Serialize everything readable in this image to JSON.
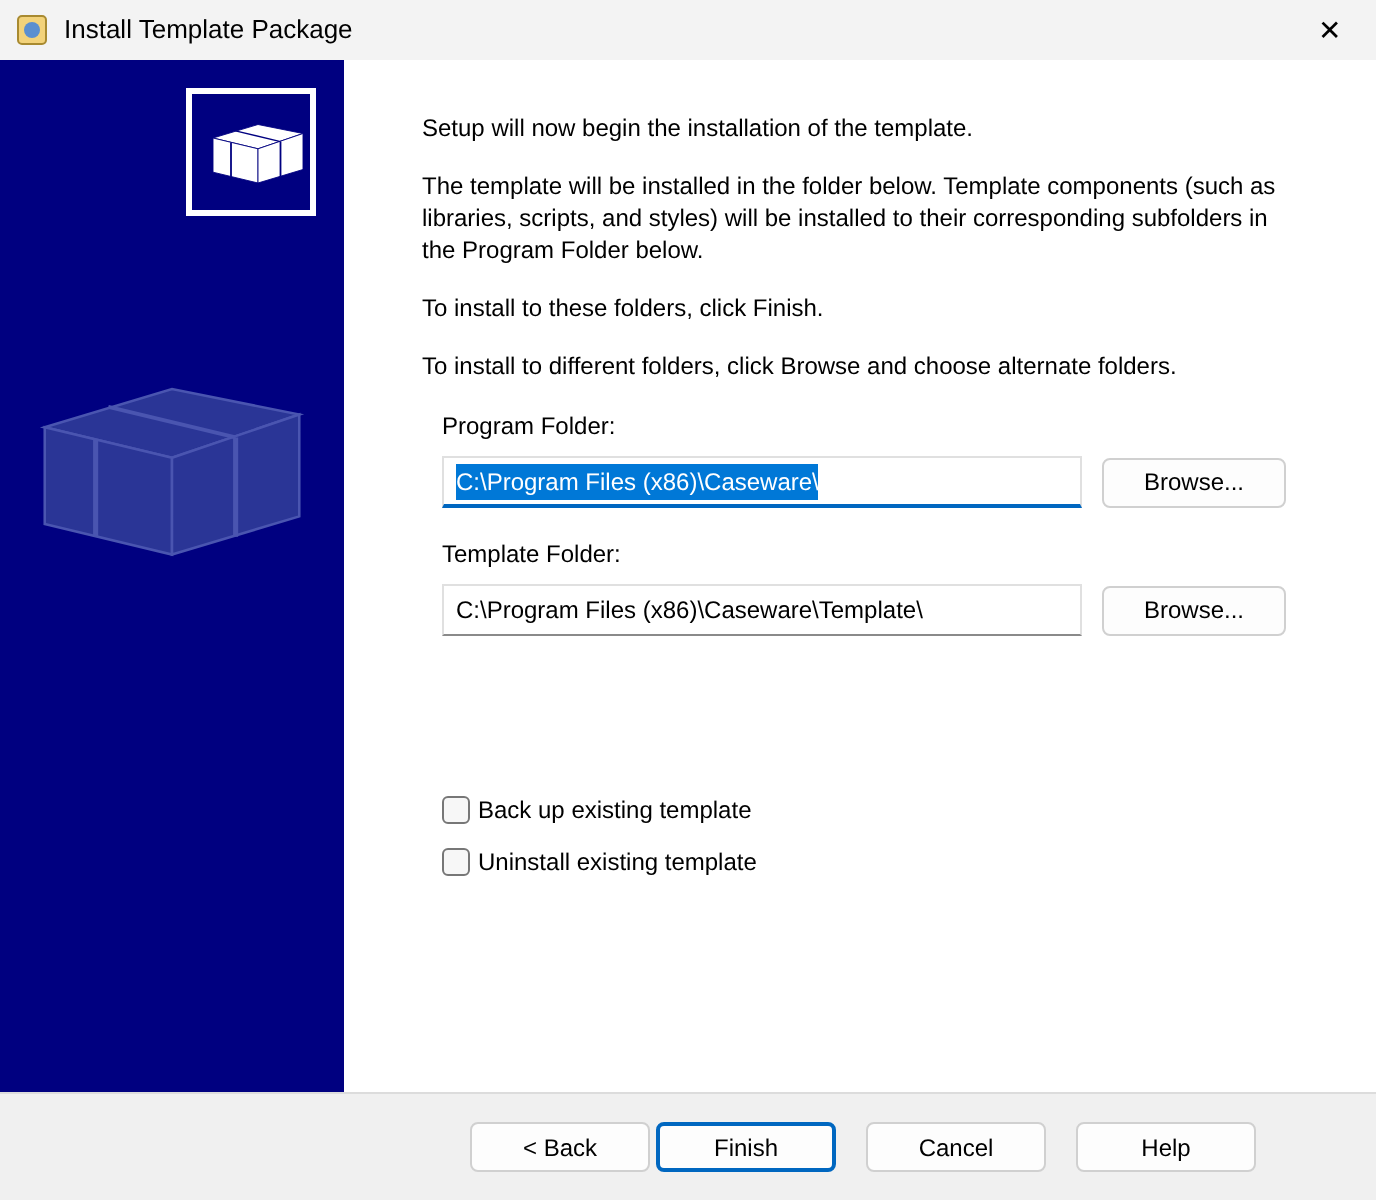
{
  "window": {
    "title": "Install Template Package",
    "close": "✕"
  },
  "paragraphs": [
    "Setup will now begin the installation of the template.",
    "The template will be installed in the folder below.  Template components (such as libraries, scripts, and styles) will be installed to their corresponding subfolders in the Program Folder below.",
    "To install to these folders, click Finish.",
    "To install to different folders, click Browse and choose alternate folders."
  ],
  "folders": [
    {
      "label": "Program Folder:",
      "value": "C:\\Program Files (x86)\\Caseware\\",
      "focused": true,
      "button": "Browse..."
    },
    {
      "label": "Template Folder:",
      "value": "C:\\Program Files (x86)\\Caseware\\Template\\",
      "focused": false,
      "button": "Browse..."
    }
  ],
  "options": [
    {
      "label": "Back up existing template",
      "checked": false
    },
    {
      "label": "Uninstall existing template",
      "checked": false
    }
  ],
  "buttons": [
    {
      "label": "< Back",
      "default": false
    },
    {
      "label": "Finish",
      "default": true
    },
    {
      "label": "Cancel",
      "default": false
    },
    {
      "label": "Help",
      "default": false
    }
  ]
}
